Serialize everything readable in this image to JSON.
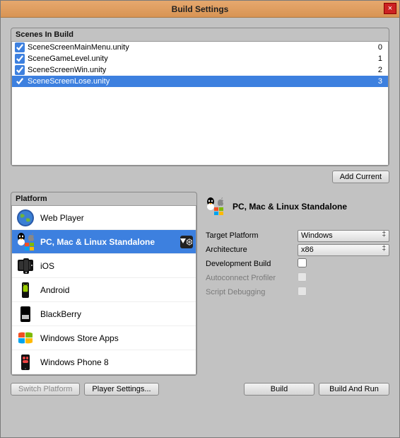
{
  "window": {
    "title": "Build Settings"
  },
  "scenes": {
    "header": "Scenes In Build",
    "items": [
      {
        "name": "SceneScreenMainMenu.unity",
        "index": "0",
        "checked": true,
        "selected": false
      },
      {
        "name": "SceneGameLevel.unity",
        "index": "1",
        "checked": true,
        "selected": false
      },
      {
        "name": "SceneScreenWin.unity",
        "index": "2",
        "checked": true,
        "selected": false
      },
      {
        "name": "SceneScreenLose.unity",
        "index": "3",
        "checked": true,
        "selected": true
      }
    ],
    "add_current": "Add Current"
  },
  "platforms": {
    "header": "Platform",
    "items": [
      {
        "label": "Web Player",
        "icon": "globe",
        "selected": false,
        "current": false
      },
      {
        "label": "PC, Mac & Linux Standalone",
        "icon": "combo",
        "selected": true,
        "current": true
      },
      {
        "label": "iOS",
        "icon": "ios",
        "selected": false,
        "current": false
      },
      {
        "label": "Android",
        "icon": "android",
        "selected": false,
        "current": false
      },
      {
        "label": "BlackBerry",
        "icon": "bb",
        "selected": false,
        "current": false
      },
      {
        "label": "Windows Store Apps",
        "icon": "winstore",
        "selected": false,
        "current": false
      },
      {
        "label": "Windows Phone 8",
        "icon": "wp",
        "selected": false,
        "current": false
      }
    ]
  },
  "settings": {
    "title": "PC, Mac & Linux Standalone",
    "rows": {
      "target_platform": {
        "label": "Target Platform",
        "value": "Windows"
      },
      "architecture": {
        "label": "Architecture",
        "value": "x86"
      },
      "dev_build": {
        "label": "Development Build",
        "checked": false
      },
      "autoconnect": {
        "label": "Autoconnect Profiler",
        "checked": false,
        "disabled": true
      },
      "script_debug": {
        "label": "Script Debugging",
        "checked": false,
        "disabled": true
      }
    }
  },
  "buttons": {
    "switch_platform": "Switch Platform",
    "player_settings": "Player Settings...",
    "build": "Build",
    "build_and_run": "Build And Run"
  }
}
